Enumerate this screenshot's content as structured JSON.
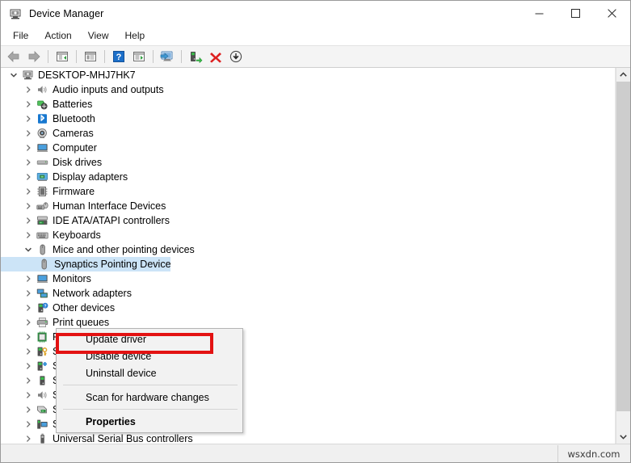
{
  "window": {
    "title": "Device Manager",
    "icon": "device-manager-icon",
    "controls": {
      "minimize": "–",
      "maximize": "□",
      "close": "✕"
    }
  },
  "menubar": {
    "items": [
      {
        "label": "File",
        "name": "menu-file"
      },
      {
        "label": "Action",
        "name": "menu-action"
      },
      {
        "label": "View",
        "name": "menu-view"
      },
      {
        "label": "Help",
        "name": "menu-help"
      }
    ]
  },
  "toolbar": {
    "buttons": [
      {
        "name": "back-button",
        "icon": "back-arrow-icon",
        "tooltip": "Back"
      },
      {
        "name": "forward-button",
        "icon": "forward-arrow-icon",
        "tooltip": "Forward"
      },
      {
        "name": "separator-1",
        "icon": "separator"
      },
      {
        "name": "show-hide-console-tree-button",
        "icon": "console-tree-icon",
        "tooltip": "Show/Hide Console Tree"
      },
      {
        "name": "separator-2",
        "icon": "separator"
      },
      {
        "name": "properties-button",
        "icon": "properties-window-icon",
        "tooltip": "Properties"
      },
      {
        "name": "separator-3",
        "icon": "separator"
      },
      {
        "name": "help-button",
        "icon": "help-question-icon",
        "tooltip": "Help"
      },
      {
        "name": "show-hide-action-pane-button",
        "icon": "action-pane-icon",
        "tooltip": "Show/Hide Action Pane"
      },
      {
        "name": "separator-4",
        "icon": "separator"
      },
      {
        "name": "scan-for-hardware-changes-button",
        "icon": "scan-hardware-icon",
        "tooltip": "Scan for hardware changes"
      },
      {
        "name": "separator-5",
        "icon": "separator"
      },
      {
        "name": "update-driver-button",
        "icon": "update-driver-icon",
        "tooltip": "Update driver"
      },
      {
        "name": "uninstall-device-button",
        "icon": "uninstall-red-x-icon",
        "tooltip": "Uninstall device"
      },
      {
        "name": "disable-device-button",
        "icon": "disable-device-arrow-icon",
        "tooltip": "Disable device"
      }
    ]
  },
  "tree": {
    "rows": [
      {
        "label": "DESKTOP-MHJ7HK7",
        "depth": 0,
        "twisty": "expanded",
        "icon": "computer-root-icon",
        "selected": false,
        "name": "tree-item-desktop-root"
      },
      {
        "label": "Audio inputs and outputs",
        "depth": 1,
        "twisty": "collapsed",
        "icon": "audio-icon",
        "selected": false,
        "name": "tree-item-audio-inputs-and-outputs"
      },
      {
        "label": "Batteries",
        "depth": 1,
        "twisty": "collapsed",
        "icon": "battery-icon",
        "selected": false,
        "name": "tree-item-batteries"
      },
      {
        "label": "Bluetooth",
        "depth": 1,
        "twisty": "collapsed",
        "icon": "bluetooth-icon",
        "selected": false,
        "name": "tree-item-bluetooth"
      },
      {
        "label": "Cameras",
        "depth": 1,
        "twisty": "collapsed",
        "icon": "camera-icon",
        "selected": false,
        "name": "tree-item-cameras"
      },
      {
        "label": "Computer",
        "depth": 1,
        "twisty": "collapsed",
        "icon": "monitor-icon",
        "selected": false,
        "name": "tree-item-computer"
      },
      {
        "label": "Disk drives",
        "depth": 1,
        "twisty": "collapsed",
        "icon": "disk-drive-icon",
        "selected": false,
        "name": "tree-item-disk-drives"
      },
      {
        "label": "Display adapters",
        "depth": 1,
        "twisty": "collapsed",
        "icon": "display-adapter-icon",
        "selected": false,
        "name": "tree-item-display-adapters"
      },
      {
        "label": "Firmware",
        "depth": 1,
        "twisty": "collapsed",
        "icon": "firmware-chip-icon",
        "selected": false,
        "name": "tree-item-firmware"
      },
      {
        "label": "Human Interface Devices",
        "depth": 1,
        "twisty": "collapsed",
        "icon": "hid-icon",
        "selected": false,
        "name": "tree-item-human-interface-devices"
      },
      {
        "label": "IDE ATA/ATAPI controllers",
        "depth": 1,
        "twisty": "collapsed",
        "icon": "ide-controller-icon",
        "selected": false,
        "name": "tree-item-ide-ata-atapi-controllers"
      },
      {
        "label": "Keyboards",
        "depth": 1,
        "twisty": "collapsed",
        "icon": "keyboard-icon",
        "selected": false,
        "name": "tree-item-keyboards"
      },
      {
        "label": "Mice and other pointing devices",
        "depth": 1,
        "twisty": "expanded",
        "icon": "mouse-icon",
        "selected": false,
        "name": "tree-item-mice-and-other-pointing-devices"
      },
      {
        "label": "Synaptics Pointing Device",
        "depth": 2,
        "twisty": "none",
        "icon": "mouse-device-icon",
        "selected": true,
        "name": "tree-item-synaptics-pointing-device"
      },
      {
        "label": "Monitors",
        "depth": 1,
        "twisty": "collapsed",
        "icon": "monitor-icon",
        "selected": false,
        "name": "tree-item-monitors"
      },
      {
        "label": "Network adapters",
        "depth": 1,
        "twisty": "collapsed",
        "icon": "network-adapter-icon",
        "selected": false,
        "name": "tree-item-network-adapters"
      },
      {
        "label": "Other devices",
        "depth": 1,
        "twisty": "collapsed",
        "icon": "other-device-icon",
        "selected": false,
        "name": "tree-item-other-devices"
      },
      {
        "label": "Print queues",
        "depth": 1,
        "twisty": "collapsed",
        "icon": "printer-icon",
        "selected": false,
        "name": "tree-item-print-queues"
      },
      {
        "label": "Processors",
        "depth": 1,
        "twisty": "collapsed",
        "icon": "processor-icon",
        "selected": false,
        "name": "tree-item-processors"
      },
      {
        "label": "Security devices",
        "depth": 1,
        "twisty": "collapsed",
        "icon": "security-device-icon",
        "selected": false,
        "name": "tree-item-security-devices"
      },
      {
        "label": "Software components",
        "depth": 1,
        "twisty": "collapsed",
        "icon": "software-component-icon",
        "selected": false,
        "name": "tree-item-software-components"
      },
      {
        "label": "Software devices",
        "depth": 1,
        "twisty": "collapsed",
        "icon": "software-device-icon",
        "selected": false,
        "name": "tree-item-software-devices"
      },
      {
        "label": "Sound, video and game controllers",
        "depth": 1,
        "twisty": "collapsed",
        "icon": "sound-controller-icon",
        "selected": false,
        "name": "tree-item-sound-video-and-game-controllers"
      },
      {
        "label": "Storage controllers",
        "depth": 1,
        "twisty": "collapsed",
        "icon": "storage-controller-icon",
        "selected": false,
        "name": "tree-item-storage-controllers"
      },
      {
        "label": "System devices",
        "depth": 1,
        "twisty": "collapsed",
        "icon": "system-device-icon",
        "selected": false,
        "name": "tree-item-system-devices"
      },
      {
        "label": "Universal Serial Bus controllers",
        "depth": 1,
        "twisty": "collapsed",
        "icon": "usb-controller-icon",
        "selected": false,
        "name": "tree-item-universal-serial-bus-controllers"
      }
    ]
  },
  "context_menu": {
    "items": [
      {
        "label": "Update driver",
        "bold": false,
        "highlighted": true,
        "name": "ctx-update-driver"
      },
      {
        "label": "Disable device",
        "bold": false,
        "highlighted": false,
        "name": "ctx-disable-device"
      },
      {
        "label": "Uninstall device",
        "bold": false,
        "highlighted": false,
        "name": "ctx-uninstall-device"
      },
      {
        "separator": true
      },
      {
        "label": "Scan for hardware changes",
        "bold": false,
        "highlighted": false,
        "name": "ctx-scan-for-hardware-changes"
      },
      {
        "separator": true
      },
      {
        "label": "Properties",
        "bold": true,
        "highlighted": false,
        "name": "ctx-properties"
      }
    ]
  },
  "statusbar": {
    "text": ""
  },
  "watermark": {
    "text": "wsxdn.com"
  },
  "colors": {
    "highlight_box": "#e31212",
    "selection": "#cce4f7",
    "toolbar_bg": "#f4f4f4",
    "menu_bg": "#f2f2f2"
  },
  "scrollbar": {
    "up_arrow": "▲",
    "down_arrow": "▼"
  }
}
